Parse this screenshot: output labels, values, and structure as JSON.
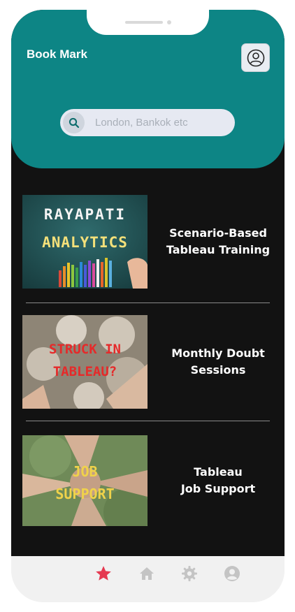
{
  "header": {
    "title": "Book Mark",
    "profile_icon": "user-circle-icon",
    "accent_color": "#0d8585"
  },
  "search": {
    "placeholder": "London, Bankok etc",
    "icon": "search-icon"
  },
  "cards": [
    {
      "image_line1": "RAYAPATI",
      "image_line2": "ANALYTICS",
      "title": "Scenario-Based\nTableau Training"
    },
    {
      "image_line1": "STRUCK IN",
      "image_line2": "TABLEAU?",
      "title": "Monthly Doubt\nSessions"
    },
    {
      "image_line1": "JOB",
      "image_line2": "SUPPORT",
      "title": "Tableau\nJob Support"
    }
  ],
  "tabbar": {
    "items": [
      {
        "icon": "star-icon",
        "active": true,
        "color": "#e53950"
      },
      {
        "icon": "home-icon",
        "active": false,
        "color": "#c4c4c4"
      },
      {
        "icon": "gear-icon",
        "active": false,
        "color": "#c4c4c4"
      },
      {
        "icon": "user-icon",
        "active": false,
        "color": "#c4c4c4"
      }
    ]
  }
}
